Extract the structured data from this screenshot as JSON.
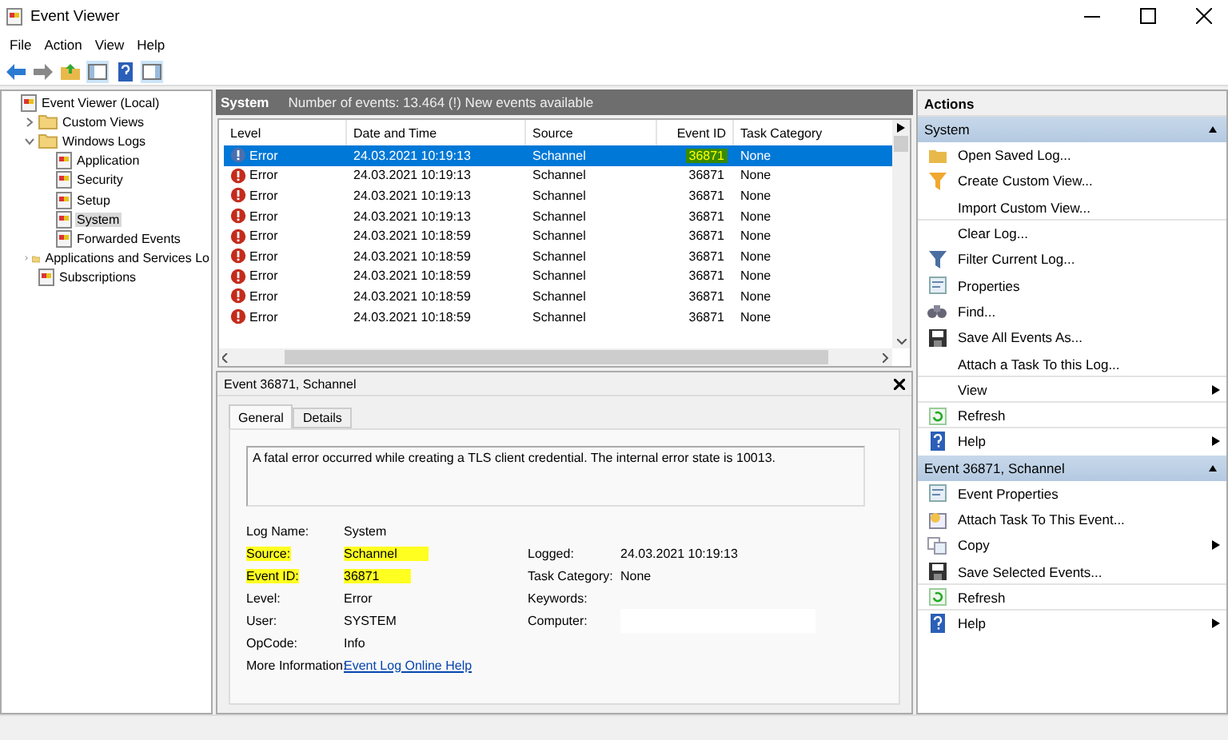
{
  "window": {
    "title": "Event Viewer"
  },
  "menu": [
    "File",
    "Action",
    "View",
    "Help"
  ],
  "tree": [
    {
      "label": "Event Viewer (Local)",
      "selected": false,
      "children": [
        {
          "label": "Custom Views",
          "expanded": false,
          "selected": false
        },
        {
          "label": "Windows Logs",
          "expanded": true,
          "selected": false,
          "children": [
            {
              "label": "Application",
              "selected": false
            },
            {
              "label": "Security",
              "selected": false
            },
            {
              "label": "Setup",
              "selected": false
            },
            {
              "label": "System",
              "selected": true
            },
            {
              "label": "Forwarded Events",
              "selected": false
            }
          ]
        },
        {
          "label": "Applications and Services Lo",
          "expanded": false,
          "selected": false
        },
        {
          "label": "Subscriptions",
          "selected": false
        }
      ]
    }
  ],
  "log_header": {
    "title": "System",
    "info": "Number of events: 13.464 (!) New events available"
  },
  "table": {
    "columns": [
      "Level",
      "Date and Time",
      "Source",
      "Event ID",
      "Task Category"
    ],
    "rows": [
      {
        "level": "Error",
        "datetime": "24.03.2021 10:19:13",
        "source": "Schannel",
        "event_id": "36871",
        "category": "None",
        "selected": true,
        "highlighted": true
      },
      {
        "level": "Error",
        "datetime": "24.03.2021 10:19:13",
        "source": "Schannel",
        "event_id": "36871",
        "category": "None",
        "selected": false,
        "highlighted": false
      },
      {
        "level": "Error",
        "datetime": "24.03.2021 10:19:13",
        "source": "Schannel",
        "event_id": "36871",
        "category": "None",
        "selected": false,
        "highlighted": false
      },
      {
        "level": "Error",
        "datetime": "24.03.2021 10:19:13",
        "source": "Schannel",
        "event_id": "36871",
        "category": "None",
        "selected": false,
        "highlighted": false
      },
      {
        "level": "Error",
        "datetime": "24.03.2021 10:18:59",
        "source": "Schannel",
        "event_id": "36871",
        "category": "None",
        "selected": false,
        "highlighted": false
      },
      {
        "level": "Error",
        "datetime": "24.03.2021 10:18:59",
        "source": "Schannel",
        "event_id": "36871",
        "category": "None",
        "selected": false,
        "highlighted": false
      },
      {
        "level": "Error",
        "datetime": "24.03.2021 10:18:59",
        "source": "Schannel",
        "event_id": "36871",
        "category": "None",
        "selected": false,
        "highlighted": false
      },
      {
        "level": "Error",
        "datetime": "24.03.2021 10:18:59",
        "source": "Schannel",
        "event_id": "36871",
        "category": "None",
        "selected": false,
        "highlighted": false
      },
      {
        "level": "Error",
        "datetime": "24.03.2021 10:18:59",
        "source": "Schannel",
        "event_id": "36871",
        "category": "None",
        "selected": false,
        "highlighted": false
      }
    ]
  },
  "detail": {
    "title": "Event 36871, Schannel",
    "tabs": [
      {
        "label": "General",
        "selected": true
      },
      {
        "label": "Details",
        "selected": false
      }
    ],
    "message": "A fatal error occurred while creating a TLS client credential. The internal error state is 10013.",
    "left_fields": [
      {
        "label": "Log Name:",
        "value": "System",
        "highlighted": false
      },
      {
        "label": "Source:",
        "value": "Schannel",
        "highlighted": true
      },
      {
        "label": "Event ID:",
        "value": "36871",
        "highlighted": true
      },
      {
        "label": "Level:",
        "value": "Error",
        "highlighted": false
      },
      {
        "label": "User:",
        "value": "SYSTEM",
        "highlighted": false
      },
      {
        "label": "OpCode:",
        "value": "Info",
        "highlighted": false
      }
    ],
    "right_fields": [
      {
        "label": "Logged:",
        "value": "24.03.2021 10:19:13",
        "redacted": false
      },
      {
        "label": "Task Category:",
        "value": "None",
        "redacted": false
      },
      {
        "label": "Keywords:",
        "redacted": false
      },
      {
        "label": "Computer:",
        "redacted": true
      }
    ],
    "more_info": {
      "label": "More Information:",
      "link": "Event Log Online Help"
    }
  },
  "actions": {
    "title": "Actions",
    "sections": [
      {
        "title": "System",
        "expanded": true,
        "items": [
          {
            "label": "Open Saved Log...",
            "submenu": false,
            "divider_after": false
          },
          {
            "label": "Create Custom View...",
            "submenu": false,
            "divider_after": false
          },
          {
            "label": "Import Custom View...",
            "submenu": false,
            "divider_after": true
          },
          {
            "label": "Clear Log...",
            "submenu": false,
            "divider_after": false
          },
          {
            "label": "Filter Current Log...",
            "submenu": false,
            "divider_after": false
          },
          {
            "label": "Properties",
            "submenu": false,
            "divider_after": false
          },
          {
            "label": "Find...",
            "submenu": false,
            "divider_after": false
          },
          {
            "label": "Save All Events As...",
            "submenu": false,
            "divider_after": false
          },
          {
            "label": "Attach a Task To this Log...",
            "submenu": false,
            "divider_after": true
          },
          {
            "label": "View",
            "submenu": true,
            "divider_after": true
          },
          {
            "label": "Refresh",
            "submenu": false,
            "divider_after": true
          },
          {
            "label": "Help",
            "submenu": true,
            "divider_after": false
          }
        ]
      },
      {
        "title": "Event 36871, Schannel",
        "expanded": true,
        "items": [
          {
            "label": "Event Properties",
            "submenu": false,
            "divider_after": false
          },
          {
            "label": "Attach Task To This Event...",
            "submenu": false,
            "divider_after": false
          },
          {
            "label": "Copy",
            "submenu": true,
            "divider_after": false
          },
          {
            "label": "Save Selected Events...",
            "submenu": false,
            "divider_after": true
          },
          {
            "label": "Refresh",
            "submenu": false,
            "divider_after": true
          },
          {
            "label": "Help",
            "submenu": true,
            "divider_after": false
          }
        ]
      }
    ]
  }
}
